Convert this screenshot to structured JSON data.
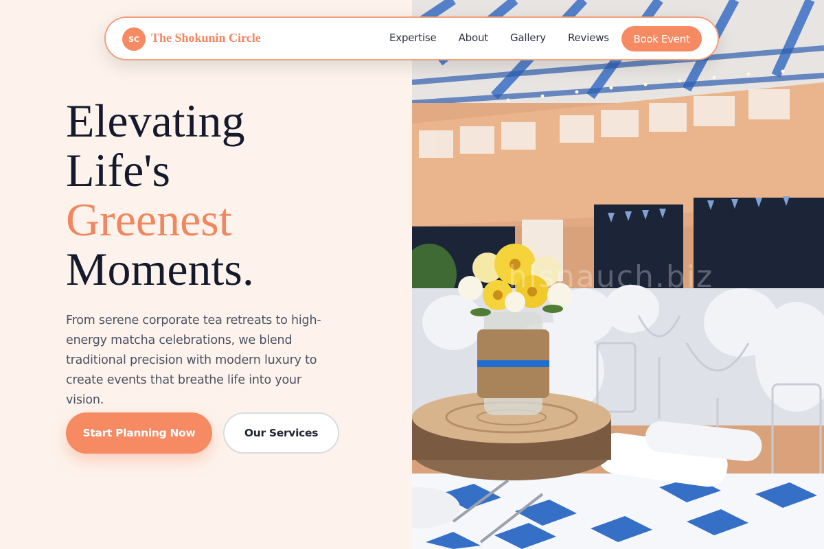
{
  "brand": {
    "initials": "SC",
    "name": "The Shokunin Circle",
    "accent_color": "#f58a63"
  },
  "nav": {
    "links": [
      "Expertise",
      "About",
      "Gallery",
      "Reviews"
    ],
    "cta_label": "Book Event"
  },
  "hero": {
    "headline_line1": "Elevating",
    "headline_line2": "Life's",
    "headline_accent": "Greenest",
    "headline_line4": "Moments.",
    "description": "From serene corporate tea retreats to high-energy matcha celebrations, we blend traditional precision with modern luxury to create events that breathe life into your vision.",
    "primary_button": "Start Planning Now",
    "secondary_button": "Our Services",
    "image_watermark": "hisnauch.biz"
  }
}
